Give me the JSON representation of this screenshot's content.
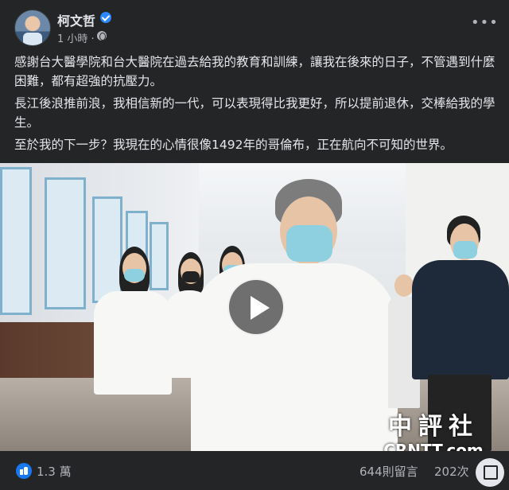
{
  "post": {
    "author": "柯文哲",
    "time": "1 小時",
    "time_separator": "·",
    "paragraphs": [
      "感謝台大醫學院和台大醫院在過去給我的教育和訓練，讓我在後來的日子，不管遇到什麼困難，都有超強的抗壓力。",
      "長江後浪推前浪，我相信新的一代，可以表現得比我更好，所以提前退休，交棒給我的學生。",
      "至於我的下一步？我現在的心情很像1492年的哥倫布，正在航向不可知的世界。"
    ]
  },
  "watermark": {
    "line1": "中評社",
    "line2": "CRNTT.com"
  },
  "footer": {
    "reactions": "1.3 萬",
    "comments": "644則留言",
    "shares": "202次"
  },
  "icons": {
    "verified": "verified-badge-icon",
    "audience": "globe-icon",
    "more": "more-options-icon",
    "play": "play-icon",
    "like": "like-reaction-icon",
    "compose": "edit-icon"
  },
  "colors": {
    "background": "#242526",
    "text": "#e4e6eb",
    "secondary_text": "#b0b3b8",
    "accent": "#1877f2"
  }
}
